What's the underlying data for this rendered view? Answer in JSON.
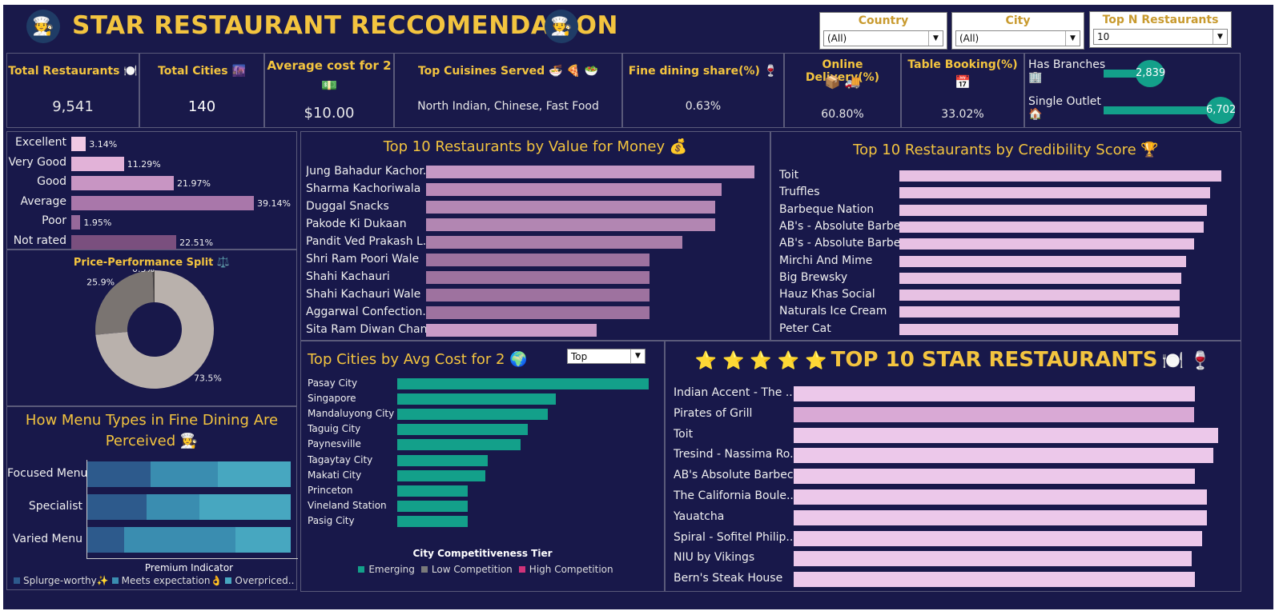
{
  "header": {
    "title": "STAR RESTAURANT RECCOMENDATION",
    "logo_icon": "chef-icon"
  },
  "filters": [
    {
      "label": "Country",
      "value": "(All)"
    },
    {
      "label": "City",
      "value": "(All)"
    },
    {
      "label": "Top N Restaurants",
      "value": "10"
    }
  ],
  "kpis": {
    "total_restaurants": {
      "label": "Total Restaurants",
      "icon": "🍽️",
      "value": "9,541"
    },
    "total_cities": {
      "label": "Total Cities",
      "icon": "🌆",
      "value": "140"
    },
    "avg_cost": {
      "label": "Average cost for 2",
      "icon": "💵",
      "value": "$10.00"
    },
    "top_cuisines": {
      "label": "Top Cuisines Served",
      "icon": "🍜 🍕 🥗",
      "value": "North Indian, Chinese, Fast Food"
    },
    "fine_dining": {
      "label": "Fine dining share(%)",
      "icon": "🍷",
      "value": "0.63%"
    },
    "online_delivery": {
      "label": "Online Delivery(%)",
      "icon": "📦 🚚",
      "value": "60.80%"
    },
    "table_booking": {
      "label": "Table Booking(%)",
      "icon": "📅",
      "value": "33.02%"
    },
    "branches": {
      "has_label": "Has Branches",
      "has_icon": "🏢",
      "has_value": "2,839",
      "single_label": "Single Outlet",
      "single_icon": "🏠",
      "single_value": "6,702"
    }
  },
  "colors": {
    "bg": "#19194a",
    "accent": "#f3c43f",
    "teal": "#13a08a",
    "pink": "#e9c3e1"
  },
  "chart_data": [
    {
      "id": "rating",
      "type": "bar",
      "categories": [
        "Excellent",
        "Very Good",
        "Good",
        "Average",
        "Poor",
        "Not rated"
      ],
      "values": [
        3.14,
        11.29,
        21.97,
        39.14,
        1.95,
        22.51
      ],
      "labels": [
        "3.14%",
        "11.29%",
        "21.97%",
        "39.14%",
        "1.95%",
        "22.51%"
      ],
      "colors": [
        "#f1c9e4",
        "#e2b2d8",
        "#c895c3",
        "#a977aa",
        "#96699a",
        "#7a4f7e"
      ]
    },
    {
      "id": "price_perf",
      "type": "pie",
      "title": "Price-Performance Split ⚖️",
      "values": [
        73.5,
        25.9,
        0.5
      ],
      "labels": [
        "73.5%",
        "25.9%",
        "0.5%"
      ],
      "colors": [
        "#b9b1ac",
        "#7a7471",
        "#4a4644"
      ]
    },
    {
      "id": "value_money",
      "type": "bar",
      "title": "Top 10 Restaurants by Value for Money 💰",
      "categories": [
        "Jung Bahadur Kachor..",
        "Sharma Kachoriwala",
        "Duggal Snacks",
        "Pakode Ki Dukaan",
        "Pandit Ved Prakash L..",
        "Shri Ram Poori Wale",
        "Shahi Kachauri",
        "Shahi Kachauri Wale",
        "Aggarwal Confection..",
        "Sita Ram Diwan Chand"
      ],
      "values": [
        100,
        90,
        88,
        88,
        78,
        68,
        68,
        68,
        68,
        52
      ],
      "colors": [
        "#c598c4",
        "#b989b7",
        "#b487b4",
        "#b286b2",
        "#a97ea9",
        "#9e729f",
        "#9e729f",
        "#9e729f",
        "#9e729f",
        "#c99bc7"
      ]
    },
    {
      "id": "credibility",
      "type": "bar",
      "title": "Top 10 Restaurants by Credibility Score 🏆",
      "categories": [
        "Toit",
        "Truffles",
        "Barbeque Nation",
        "AB's - Absolute Barbe..",
        "AB's - Absolute Barbe..",
        "Mirchi And Mime",
        "Big Brewsky",
        "Hauz Khas Social",
        "Naturals Ice Cream",
        "Peter Cat"
      ],
      "values": [
        100,
        96.5,
        95.5,
        94.5,
        91.5,
        89,
        87.5,
        87,
        87,
        86.5
      ],
      "color": "#e7c1e3"
    },
    {
      "id": "cities_cost",
      "type": "bar",
      "title": "Top Cities by Avg Cost for 2 🌍",
      "categories": [
        "Pasay City",
        "Singapore",
        "Mandaluyong City",
        "Taguig City",
        "Paynesville",
        "Tagaytay City",
        "Makati City",
        "Princeton",
        "Vineland Station",
        "Pasig City"
      ],
      "values": [
        100,
        63,
        60,
        52,
        49,
        36,
        35,
        28,
        28,
        28
      ],
      "legend_title": "City Competitiveness Tier",
      "legend": [
        {
          "name": "Emerging",
          "color": "#13a08a"
        },
        {
          "name": "Low Competition",
          "color": "#7a7a7a"
        },
        {
          "name": "High Competition",
          "color": "#d0337a"
        }
      ],
      "dropdown": "Top"
    },
    {
      "id": "menu_perception",
      "type": "bar",
      "stacked": true,
      "title": "How Menu Types in Fine Dining Are Perceived 👩‍🍳",
      "categories": [
        "Focused Menu",
        "Specialist",
        "Varied Menu"
      ],
      "xlabel": "Premium Indicator",
      "series": [
        {
          "name": "Splurge-worthy✨",
          "values": [
            31,
            29,
            18
          ],
          "color": "#2d5a8c"
        },
        {
          "name": "Meets expectation👌",
          "values": [
            33,
            26,
            55
          ],
          "color": "#3a8db0"
        },
        {
          "name": "Overpriced..",
          "values": [
            36,
            45,
            27
          ],
          "color": "#47a7c0"
        }
      ]
    },
    {
      "id": "star_restaurants",
      "type": "bar",
      "title": "TOP 10 STAR RESTAURANTS",
      "title_prefix": "⭐ ⭐ ⭐ ⭐ ⭐",
      "title_suffix": "🍽️ 🍷",
      "categories": [
        "Indian Accent - The ..",
        "Pirates of Grill",
        "Toit",
        "Tresind - Nassima Ro..",
        "AB's Absolute Barbec..",
        "The California Boule..",
        "Yauatcha",
        "Spiral - Sofitel Philip..",
        "NIU by Vikings",
        "Bern's Steak House"
      ],
      "values": [
        94.5,
        94.3,
        100,
        98.8,
        94.5,
        97.3,
        97.3,
        96.3,
        93.7,
        94.5
      ],
      "colors": [
        "#ecc8ea",
        "#d9a9d5",
        "#ecc8ea",
        "#ecc8ea",
        "#ecc8ea",
        "#ecc8ea",
        "#ecc8ea",
        "#ecc8ea",
        "#ecc8ea",
        "#ecc8ea"
      ]
    }
  ]
}
